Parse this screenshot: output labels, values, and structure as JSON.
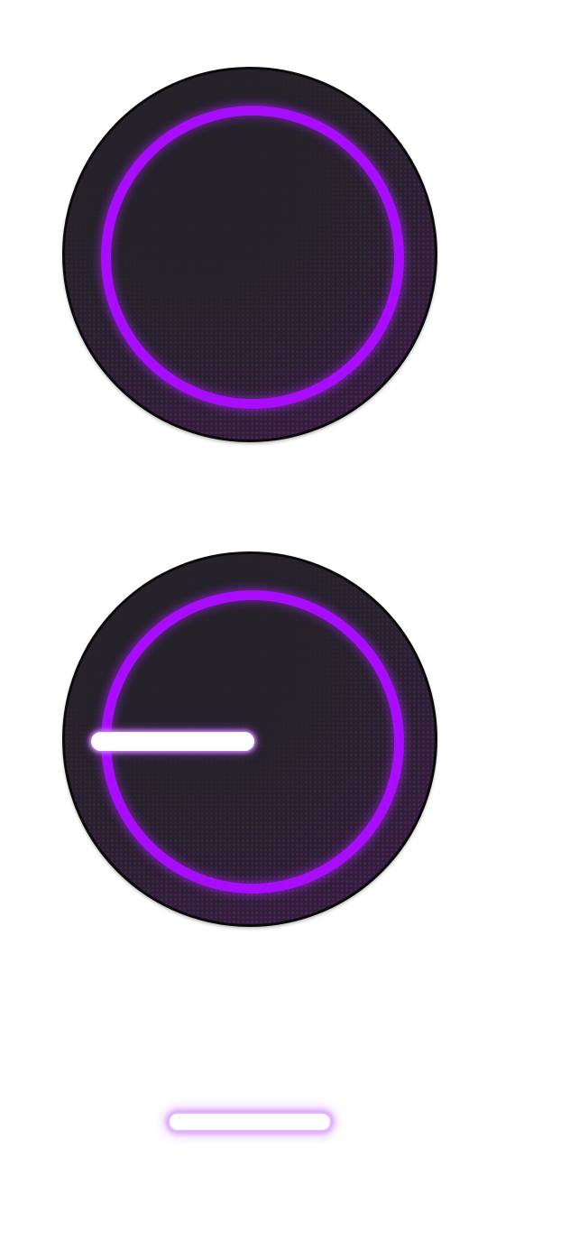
{
  "colors": {
    "accent_ring": "#a90dff",
    "knob_face": "#252229",
    "knob_border": "#0b0b0c",
    "indicator": "#ffffff",
    "glow": "#d68cff"
  },
  "controls": {
    "knob_top": {
      "kind": "rotary-knob",
      "indicator_visible": false
    },
    "knob_bottom": {
      "kind": "rotary-knob",
      "indicator_visible": true,
      "indicator_direction": "left"
    },
    "bar": {
      "kind": "glowing-bar"
    }
  }
}
